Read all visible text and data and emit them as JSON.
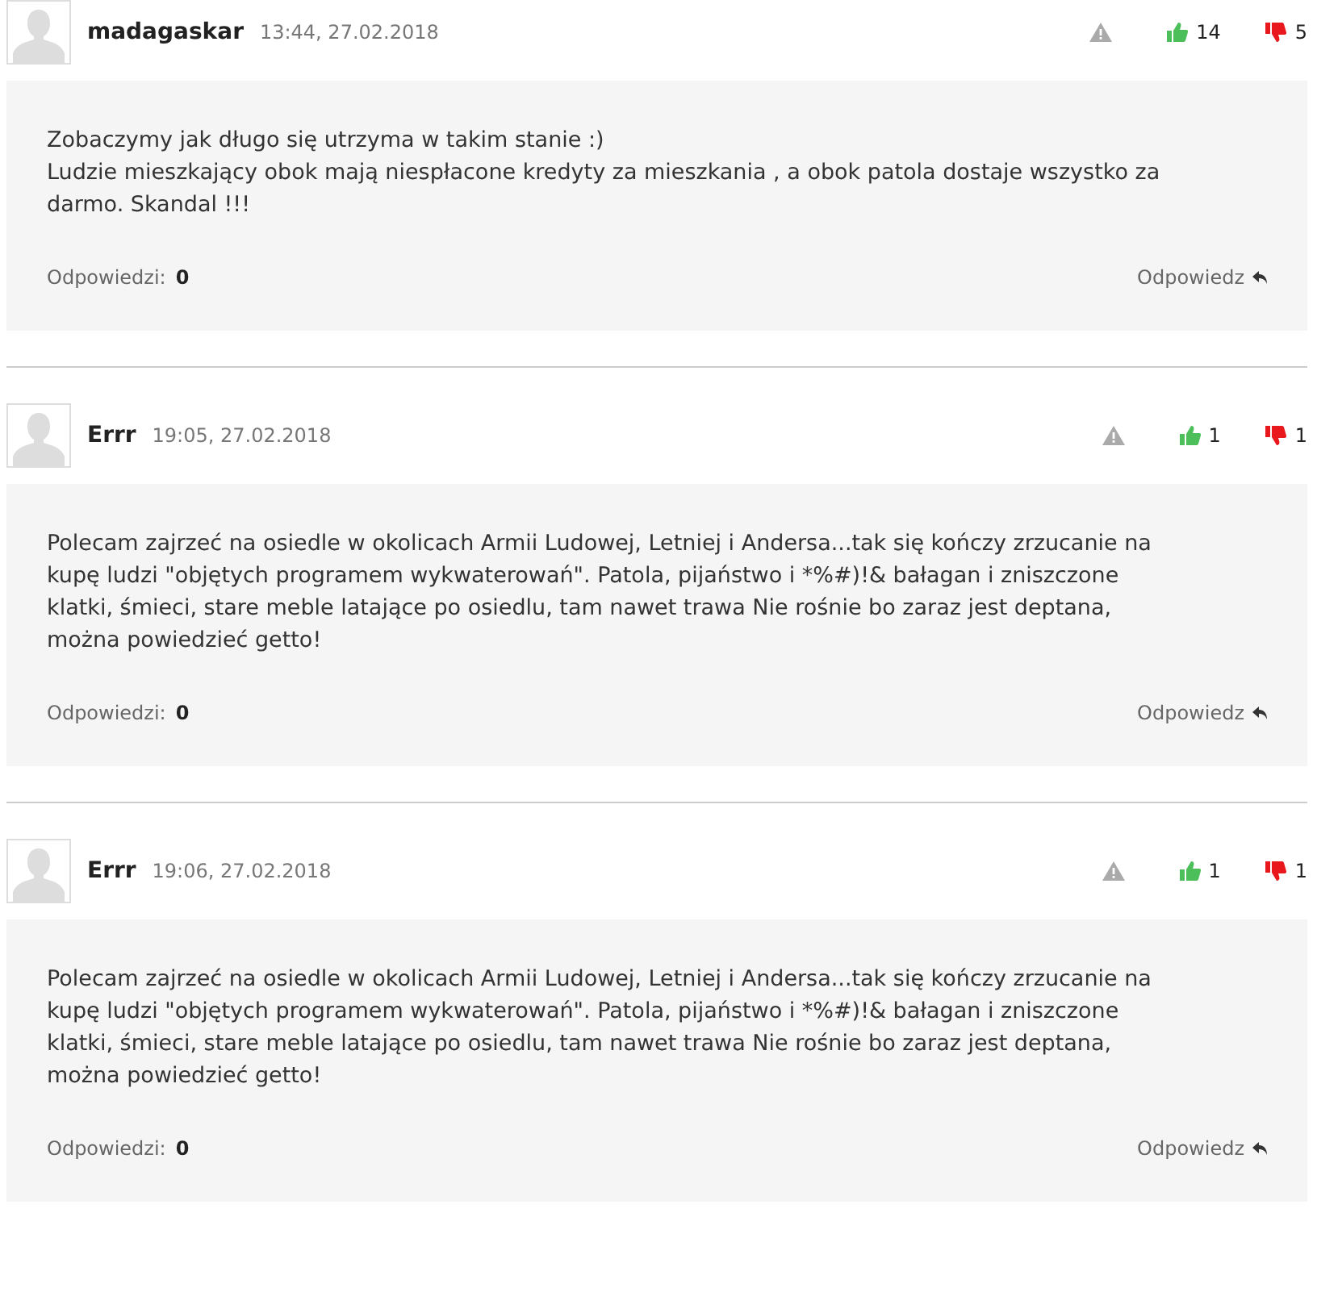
{
  "comments": [
    {
      "author": "madagaskar",
      "time": "13:44, 27.02.2018",
      "upvotes": "14",
      "downvotes": "5",
      "paragraphs": [
        "Zobaczymy jak długo się utrzyma w takim stanie :)",
        "Ludzie mieszkający obok mają niespłacone kredyty za mieszkania , a obok patola dostaje wszystko za darmo. Skandal !!!"
      ],
      "replies_label": "Odpowiedzi:",
      "replies_count": "0",
      "reply_link": "Odpowiedz"
    },
    {
      "author": "Errr",
      "time": "19:05, 27.02.2018",
      "upvotes": "1",
      "downvotes": "1",
      "paragraphs": [
        "Polecam zajrzeć na osiedle w okolicach Armii Ludowej, Letniej i Andersa...tak się kończy zrzucanie na kupę ludzi \"objętych programem wykwaterowań\". Patola, pijaństwo i *%#)!& bałagan i zniszczone klatki, śmieci, stare meble latające po osiedlu, tam nawet trawa Nie rośnie bo zaraz jest deptana, można powiedzieć getto!"
      ],
      "replies_label": "Odpowiedzi:",
      "replies_count": "0",
      "reply_link": "Odpowiedz"
    },
    {
      "author": "Errr",
      "time": "19:06, 27.02.2018",
      "upvotes": "1",
      "downvotes": "1",
      "paragraphs": [
        "Polecam zajrzeć na osiedle w okolicach Armii Ludowej, Letniej i Andersa...tak się kończy zrzucanie na kupę ludzi \"objętych programem wykwaterowań\". Patola, pijaństwo i *%#)!& bałagan i zniszczone klatki, śmieci, stare meble latające po osiedlu, tam nawet trawa Nie rośnie bo zaraz jest deptana, można powiedzieć getto!"
      ],
      "replies_label": "Odpowiedzi:",
      "replies_count": "0",
      "reply_link": "Odpowiedz"
    }
  ]
}
